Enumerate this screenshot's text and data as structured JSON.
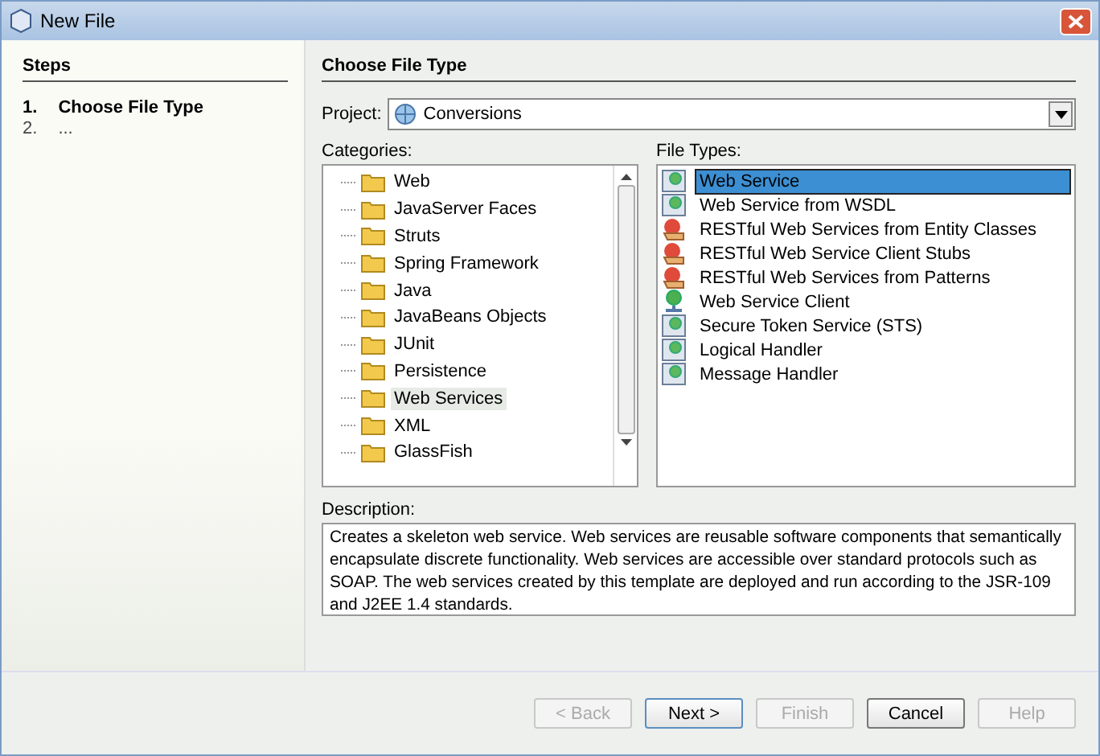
{
  "window": {
    "title": "New File"
  },
  "steps": {
    "title": "Steps",
    "items": [
      {
        "number": "1.",
        "label": "Choose File Type",
        "selected": true
      },
      {
        "number": "2.",
        "label": "...",
        "selected": false
      }
    ]
  },
  "panel_title": "Choose File Type",
  "project": {
    "label": "Project:",
    "value": "Conversions"
  },
  "categories": {
    "label": "Categories:",
    "items": [
      {
        "label": "Web",
        "selected": false
      },
      {
        "label": "JavaServer Faces",
        "selected": false
      },
      {
        "label": "Struts",
        "selected": false
      },
      {
        "label": "Spring Framework",
        "selected": false
      },
      {
        "label": "Java",
        "selected": false
      },
      {
        "label": "JavaBeans Objects",
        "selected": false
      },
      {
        "label": "JUnit",
        "selected": false
      },
      {
        "label": "Persistence",
        "selected": false
      },
      {
        "label": "Web Services",
        "selected": true
      },
      {
        "label": "XML",
        "selected": false
      },
      {
        "label": "GlassFish",
        "selected": false
      }
    ]
  },
  "file_types": {
    "label": "File Types:",
    "items": [
      {
        "label": "Web Service",
        "kind": "service",
        "selected": true
      },
      {
        "label": "Web Service from WSDL",
        "kind": "service",
        "selected": false
      },
      {
        "label": "RESTful Web Services from Entity Classes",
        "kind": "rest",
        "selected": false
      },
      {
        "label": "RESTful Web Service Client Stubs",
        "kind": "rest",
        "selected": false
      },
      {
        "label": "RESTful Web Services from Patterns",
        "kind": "rest",
        "selected": false
      },
      {
        "label": "Web Service Client",
        "kind": "client",
        "selected": false
      },
      {
        "label": "Secure Token Service (STS)",
        "kind": "service",
        "selected": false
      },
      {
        "label": "Logical Handler",
        "kind": "service",
        "selected": false
      },
      {
        "label": "Message Handler",
        "kind": "service",
        "selected": false
      }
    ]
  },
  "description": {
    "label": "Description:",
    "text": "Creates a skeleton web service. Web services are reusable software components that semantically encapsulate discrete functionality. Web services are accessible over standard protocols such as SOAP. The web services created by this template are deployed and run according to the JSR-109 and J2EE 1.4 standards."
  },
  "buttons": [
    {
      "label": "< Back",
      "disabled": true,
      "default": false
    },
    {
      "label": "Next >",
      "disabled": false,
      "default": true
    },
    {
      "label": "Finish",
      "disabled": true,
      "default": false
    },
    {
      "label": "Cancel",
      "disabled": false,
      "default": false
    },
    {
      "label": "Help",
      "disabled": true,
      "default": false
    }
  ]
}
